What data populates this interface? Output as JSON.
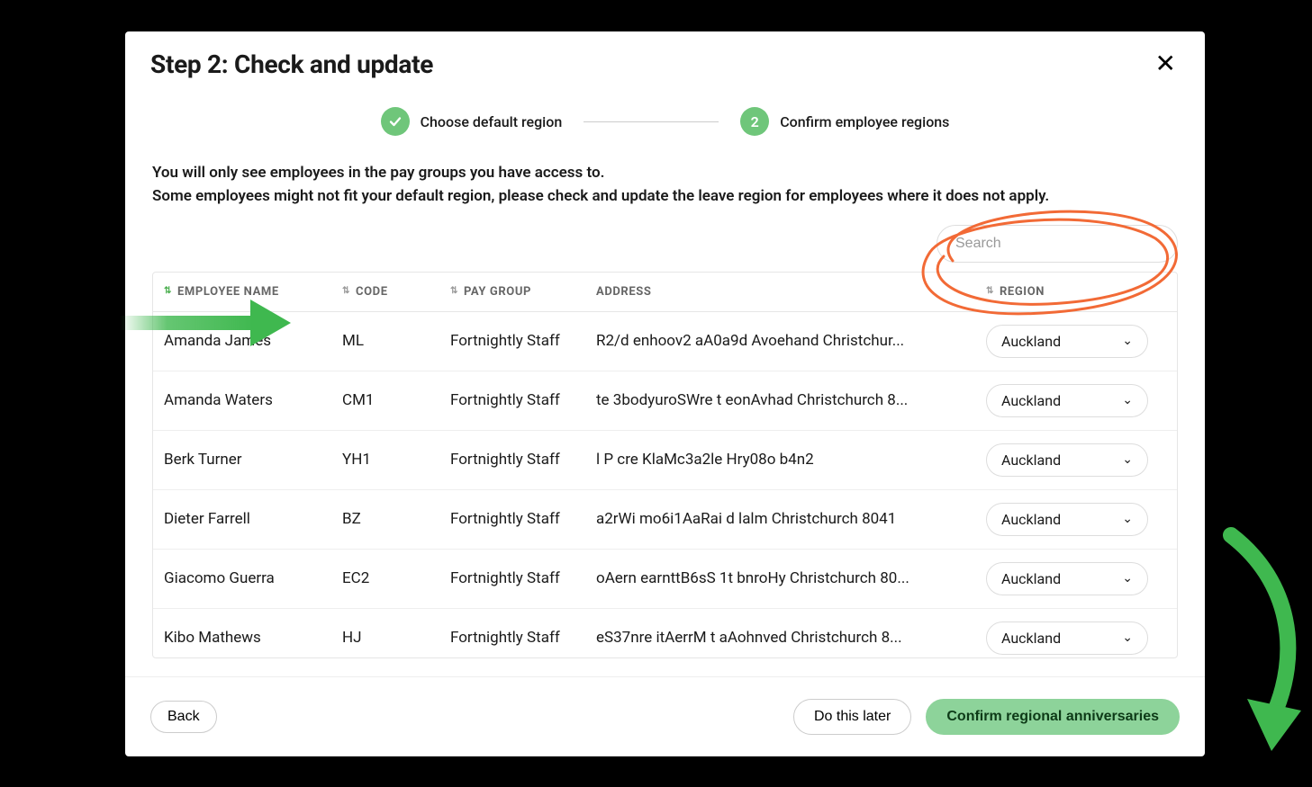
{
  "modal": {
    "title": "Step 2: Check and update"
  },
  "stepper": {
    "step1": {
      "label": "Choose default region",
      "icon": "check"
    },
    "step2": {
      "label": "Confirm employee regions",
      "number": "2"
    }
  },
  "instructions": {
    "line1": "You will only see employees in the pay groups you have access to.",
    "line2": "Some employees might not fit your default region, please check and update the leave region for employees where it does not apply."
  },
  "search": {
    "placeholder": "Search",
    "value": ""
  },
  "table": {
    "columns": {
      "name": "EMPLOYEE NAME",
      "code": "CODE",
      "paygroup": "PAY GROUP",
      "address": "ADDRESS",
      "region": "REGION"
    },
    "rows": [
      {
        "name": "Amanda James",
        "code": "ML",
        "paygroup": "Fortnightly Staff",
        "address": "R2/d enhoov2 aA0a9d Avoehand Christchur...",
        "region": "Auckland"
      },
      {
        "name": "Amanda Waters",
        "code": "CM1",
        "paygroup": "Fortnightly Staff",
        "address": "te 3bodyuroSWre t eonAvhad Christchurch 8...",
        "region": "Auckland"
      },
      {
        "name": "Berk Turner",
        "code": "YH1",
        "paygroup": "Fortnightly Staff",
        "address": "l P cre KlaMc3a2le Hry08o b4n2",
        "region": "Auckland"
      },
      {
        "name": "Dieter Farrell",
        "code": "BZ",
        "paygroup": "Fortnightly Staff",
        "address": "a2rWi mo6i1AaRai d lalm Christchurch 8041",
        "region": "Auckland"
      },
      {
        "name": "Giacomo Guerra",
        "code": "EC2",
        "paygroup": "Fortnightly Staff",
        "address": "oAern earnttB6sS 1t bnroHy Christchurch 80...",
        "region": "Auckland"
      },
      {
        "name": "Kibo Mathews",
        "code": "HJ",
        "paygroup": "Fortnightly Staff",
        "address": "eS37nre itAerrM t aAohnved Christchurch 8...",
        "region": "Auckland"
      }
    ]
  },
  "footer": {
    "back": "Back",
    "later": "Do this later",
    "confirm": "Confirm regional anniversaries"
  },
  "colors": {
    "accent_green": "#6fc67a",
    "button_green": "#8dd39a",
    "annotation_orange": "#f26a36",
    "annotation_green": "#3fb84f"
  }
}
